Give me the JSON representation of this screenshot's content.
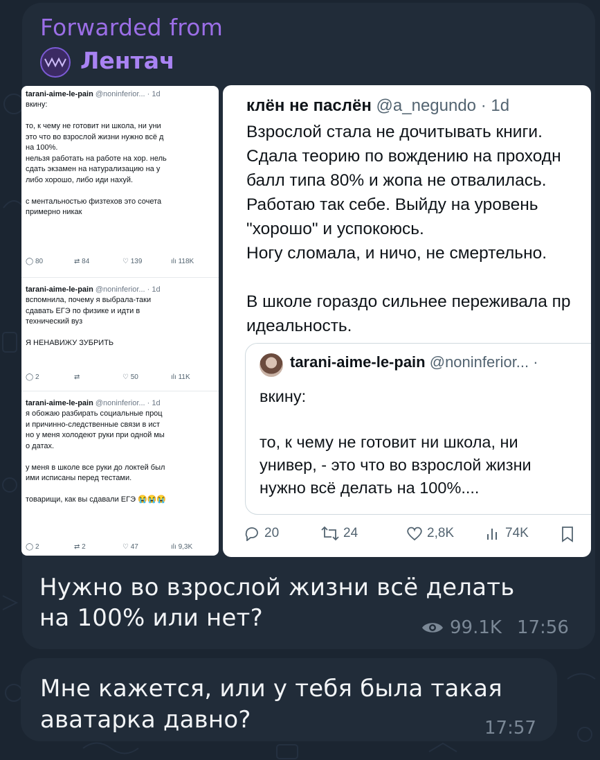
{
  "forwarded": {
    "label": "Forwarded from",
    "channel": "Лентач",
    "avatar_glyph": "ᨓᨓ"
  },
  "left_tweets": [
    {
      "name": "tarani-aime-le-pain",
      "handle": "@noninferior... · 1d",
      "lines": [
        "вкину:",
        "",
        "то, к чему не готовит ни школа, ни уни",
        "это что во взрослой жизни нужно всё д",
        "на 100%.",
        "нельзя работать на работе на хор. нель",
        "сдать экзамен на натурализацию на у",
        "либо хорошо, либо иди нахуй.",
        "",
        "с ментальностью физтехов это сочета",
        "примерно никак"
      ],
      "stats": {
        "replies": "80",
        "retweets": "84",
        "likes": "139",
        "views": "118K"
      }
    },
    {
      "name": "tarani-aime-le-pain",
      "handle": "@noninferior... · 1d",
      "lines": [
        "вспомнила, почему я выбрала-таки",
        "сдавать ЕГЭ по физике и идти в",
        "технический вуз",
        "",
        "Я НЕНАВИЖУ ЗУБРИТЬ"
      ],
      "stats": {
        "replies": "2",
        "retweets": "",
        "likes": "50",
        "views": "11K"
      }
    },
    {
      "name": "tarani-aime-le-pain",
      "handle": "@noninferior... · 1d",
      "lines": [
        "я обожаю разбирать социальные проц",
        "и причинно-следственные связи в ист",
        "но у меня холодеют руки при одной мы",
        "о датах.",
        "",
        "у меня в школе все руки до локтей был",
        "ими исписаны перед тестами.",
        "",
        "товарищи, как вы сдавали ЕГЭ 😭😭😭"
      ],
      "stats": {
        "replies": "2",
        "retweets": "2",
        "likes": "47",
        "views": "9,3K"
      }
    }
  ],
  "main_tweet": {
    "name": "клён не паслён",
    "handle": "@a_negundo · 1d",
    "lines": [
      "Взрослой стала не дочитывать книги.",
      "Сдала теорию по вождению на проходн",
      "балл типа 80% и жопа не отвалилась.",
      "Работаю так себе. Выйду на уровень",
      "\"хорошо\" и успокоюсь.",
      "Ногу сломала, и ничо, не смертельно.",
      "",
      "В школе гораздо сильнее переживала пр",
      "идеальность."
    ],
    "quote": {
      "name": "tarani-aime-le-pain",
      "handle": "@noninferior... ·",
      "lines": [
        "вкину:",
        "",
        "то, к чему не готовит ни школа, ни",
        "универ, - это что во взрослой жизни",
        "нужно всё делать на 100%...."
      ]
    },
    "stats": {
      "replies": "20",
      "retweets": "24",
      "likes": "2,8K",
      "views": "74K"
    }
  },
  "caption": {
    "line1": "Нужно во взрослой жизни всё делать",
    "line2": "на 100% или нет?",
    "views": "99.1K",
    "time": "17:56"
  },
  "reply": {
    "line1": "Мне кажется, или у тебя была такая",
    "line2": "аватарка давно?",
    "time": "17:57"
  },
  "colors": {
    "background": "#1b2531",
    "bubble": "#212c39",
    "forward_accent": "#9b6ee6",
    "text": "#f2f4f6",
    "meta": "#7b8896"
  }
}
